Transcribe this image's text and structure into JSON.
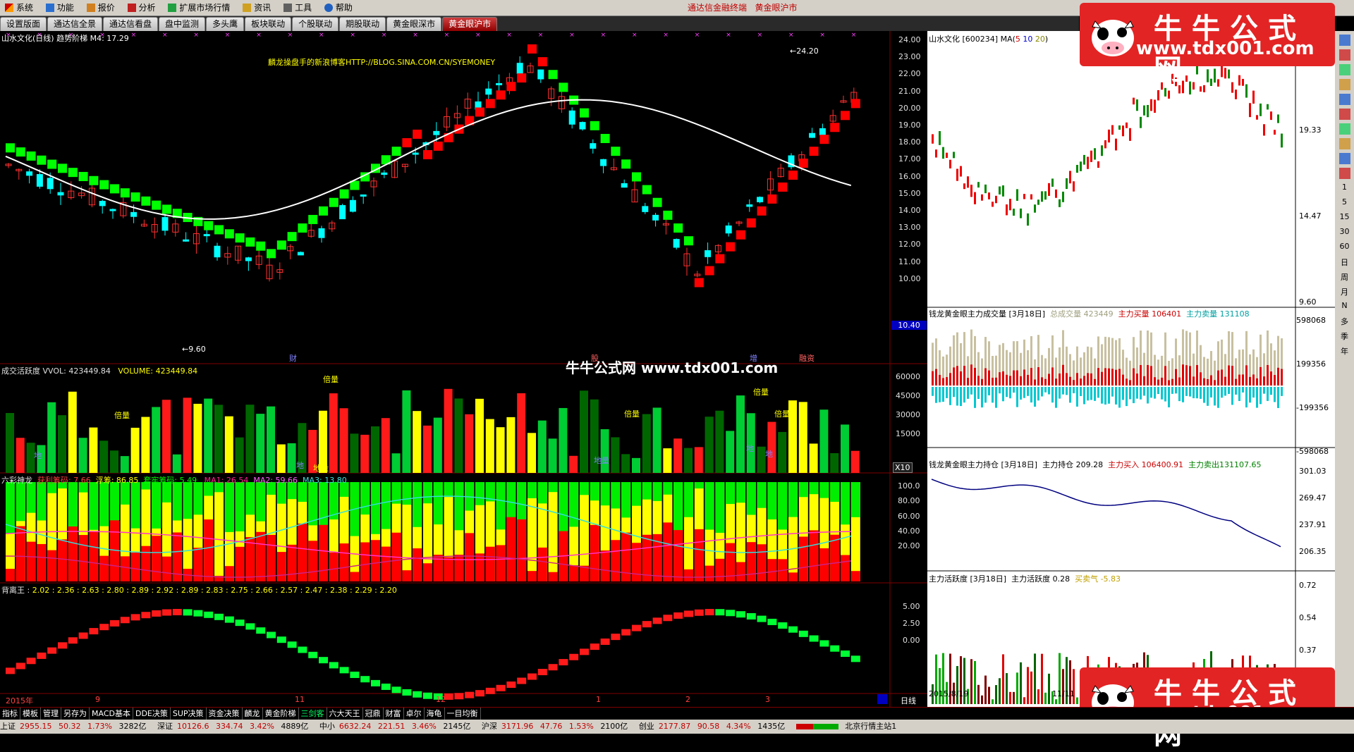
{
  "menu": {
    "items": [
      "系统",
      "功能",
      "报价",
      "分析",
      "扩展市场行情",
      "资讯",
      "工具",
      "帮助"
    ],
    "center_left": "通达信金融终端",
    "center_right": "黄金眼沪市"
  },
  "tabs": [
    "设置版面",
    "通达信全景",
    "通达信看盘",
    "盘中监测",
    "多头鹰",
    "板块联动",
    "个股联动",
    "期股联动",
    "黄金眼深市",
    "黄金眼沪市"
  ],
  "active_tab_index": 9,
  "main_chart": {
    "title": "山水文化(日线) 趋势阶梯",
    "ma_label": "M4: 17.29",
    "watermark_text": "麟龙操盘手的新浪博客HTTP://BLOG.SINA.COM.CN/SYEMONEY",
    "high_label": "24.20",
    "low_label": "9.60",
    "price_tag": "10.40",
    "y_ticks": [
      "24.00",
      "23.00",
      "22.00",
      "21.00",
      "20.00",
      "19.00",
      "18.00",
      "17.00",
      "16.00",
      "15.00",
      "14.00",
      "13.00",
      "12.00",
      "11.00",
      "10.00"
    ],
    "event_labels": [
      "财",
      "股",
      "增",
      "融资"
    ],
    "center_overlay": "牛牛公式网 www.tdx001.com"
  },
  "volume_panel": {
    "title": "成交活跃度 VVOL: 423449.84",
    "vol_label": "VOLUME: 423449.84",
    "y_ticks": [
      "60000",
      "45000",
      "30000",
      "15000"
    ],
    "unit": "X10",
    "tags": [
      "倍量",
      "倍量",
      "倍量",
      "倍量",
      "倍量"
    ],
    "small_tags": [
      "地",
      "地",
      "地量",
      "地量",
      "地",
      "地"
    ]
  },
  "six_color": {
    "title": "六彩神龙",
    "profit_label": "获利筹码: 7.66",
    "float_label": "浮筹: 86.85",
    "locked_label": "套牢筹码: 5.49",
    "ma1": "MA1: 26.54",
    "ma2": "MA2: 59.66",
    "ma3": "MA3: 13.80",
    "y_ticks": [
      "100.0",
      "80.00",
      "60.00",
      "40.00",
      "20.00"
    ]
  },
  "divergence": {
    "title": "背离王",
    "values": "2.02 : 2.36 : 2.63 : 2.80 : 2.89 : 2.92 : 2.89 : 2.83 : 2.75 : 2.66 : 2.57 : 2.47 : 2.38 : 2.29 : 2.20",
    "y_ticks": [
      "5.00",
      "2.50",
      "0.00"
    ]
  },
  "time_axis": {
    "labels": [
      "2015年",
      "9",
      "11",
      "12",
      "1",
      "2",
      "3"
    ],
    "period": "日线"
  },
  "right_top": {
    "title": "山水文化",
    "code": "[600234]",
    "ma": "MA(",
    "ma_vals": [
      "5",
      "10",
      "20"
    ],
    "ma_close": ")",
    "y_ticks": [
      "19.33",
      "14.47",
      "9.60"
    ]
  },
  "right_vol": {
    "title": "钱龙黄金眼主力成交量 [3月18日]",
    "total": "总成交量 423449",
    "buy": "主力买量 106401",
    "sell": "主力卖量 131108",
    "y_ticks": [
      "598068",
      "199356",
      "-199356",
      "-598068"
    ]
  },
  "right_hold": {
    "title": "钱龙黄金眼主力持仓 [3月18日]",
    "hold": "主力持仓 209.28",
    "buy": "主力买入 106400.91",
    "sell": "主力卖出131107.65",
    "y_ticks": [
      "301.03",
      "269.47",
      "237.91",
      "206.35"
    ]
  },
  "right_act": {
    "title": "主力活跃度 [3月18日]",
    "act": "主力活跃度 0.28",
    "mood": "买卖气 -5.83",
    "y_ticks": [
      "0.72",
      "0.54",
      "0.37"
    ],
    "dates": [
      "2015/8/19",
      "11/11"
    ]
  },
  "ads": {
    "title": "牛牛公式网",
    "url": "www.tdx001.com"
  },
  "right_toolbar": [
    "1",
    "5",
    "15",
    "30",
    "60",
    "日",
    "周",
    "月",
    "N",
    "多",
    "季",
    "年"
  ],
  "bottom_tabs": [
    "指标",
    "模板",
    "管理",
    "另存为",
    "MACD基本",
    "DDE决策",
    "SUP决策",
    "资金决策",
    "麟龙",
    "黄金阶梯",
    "三剑客",
    "六大天王",
    "冠鼎",
    "财富",
    "卓尔",
    "海龟",
    "一目均衡"
  ],
  "bottom_selected": 10,
  "status": {
    "sh": "上证",
    "sh_val": "2955.15",
    "sh_chg": "50.32",
    "sh_pct": "1.73%",
    "sh_amt": "3282亿",
    "sz": "深证",
    "sz_val": "10126.6",
    "sz_chg": "334.74",
    "sz_pct": "3.42%",
    "sz_amt": "4889亿",
    "zx": "中小",
    "zx_val": "6632.24",
    "zx_chg": "221.51",
    "zx_pct": "3.46%",
    "zx_amt": "2145亿",
    "hs": "沪深",
    "hs_val": "3171.96",
    "hs_chg": "47.76",
    "hs_pct": "1.53%",
    "hs_amt": "2100亿",
    "cy": "创业",
    "cy_val": "2177.87",
    "cy_chg": "90.58",
    "cy_pct": "4.34%",
    "cy_amt": "1435亿",
    "station": "北京行情主站1"
  },
  "colors": {
    "up": "#ff2020",
    "down": "#00ffff",
    "step_up": "#ff0000",
    "step_down": "#00ff00",
    "gold": "#ffff00"
  }
}
